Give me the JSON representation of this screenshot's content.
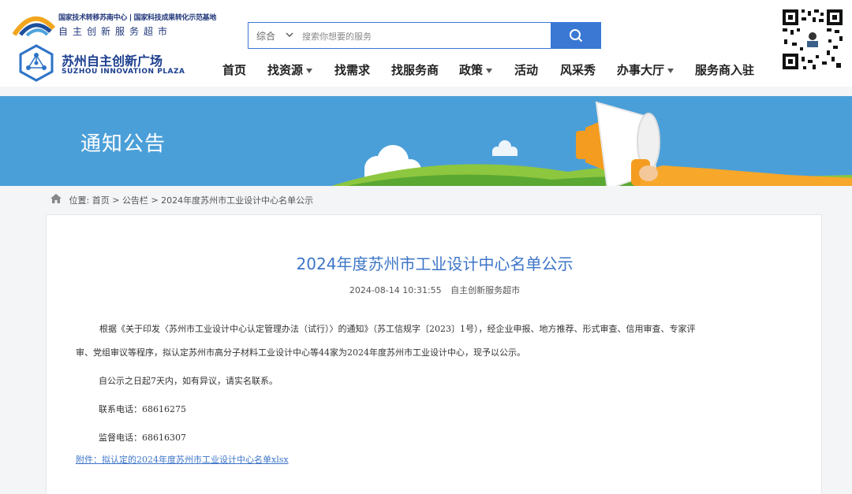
{
  "header": {
    "org_line1": "国家技术转移苏南中心 | 国家科技成果转化示范基地",
    "org_line2": "自主创新服务超市",
    "site_name": "苏州自主创新广场",
    "site_name_en": "SUZHOU INNOVATION PLAZA",
    "search": {
      "category": "综合",
      "placeholder": "搜索你想要的服务",
      "button_icon": "search-icon"
    },
    "qr_icon": "qr-code-icon"
  },
  "nav": {
    "items": [
      {
        "label": "首页",
        "dropdown": false
      },
      {
        "label": "找资源",
        "dropdown": true
      },
      {
        "label": "找需求",
        "dropdown": false
      },
      {
        "label": "找服务商",
        "dropdown": false
      },
      {
        "label": "政策",
        "dropdown": true
      },
      {
        "label": "活动",
        "dropdown": false
      },
      {
        "label": "风采秀",
        "dropdown": false
      },
      {
        "label": "办事大厅",
        "dropdown": true
      },
      {
        "label": "服务商入驻",
        "dropdown": false
      }
    ]
  },
  "banner": {
    "title": "通知公告",
    "color": "#4b9fd8",
    "icon": "megaphone-icon"
  },
  "breadcrumb": {
    "prefix": "位置:",
    "home": "首页",
    "sep": ">",
    "section": "公告栏",
    "current": "2024年度苏州市工业设计中心名单公示"
  },
  "article": {
    "title": "2024年度苏州市工业设计中心名单公示",
    "date": "2024-08-14 10:31:55",
    "source": "自主创新服务超市",
    "para1_line1": "根据《关于印发〈苏州市工业设计中心认定管理办法（试行）〉的通知》（苏工信规字〔2023〕1号），经企业申报、地方推荐、形式审查、信用审查、专家评",
    "para1_line2": "审、党组审议等程序，拟认定苏州市高分子材料工业设计中心等44家为2024年度苏州市工业设计中心，现予以公示。",
    "para2": "自公示之日起7天内，如有异议，请实名联系。",
    "contact": "联系电话：68616275",
    "supervise": "监督电话：68616307",
    "attachment": "附件：拟认定的2024年度苏州市工业设计中心名单xlsx"
  },
  "colors": {
    "accent": "#3a78d4",
    "title_blue": "#3d75c7",
    "brand_navy": "#1d3f8f"
  }
}
